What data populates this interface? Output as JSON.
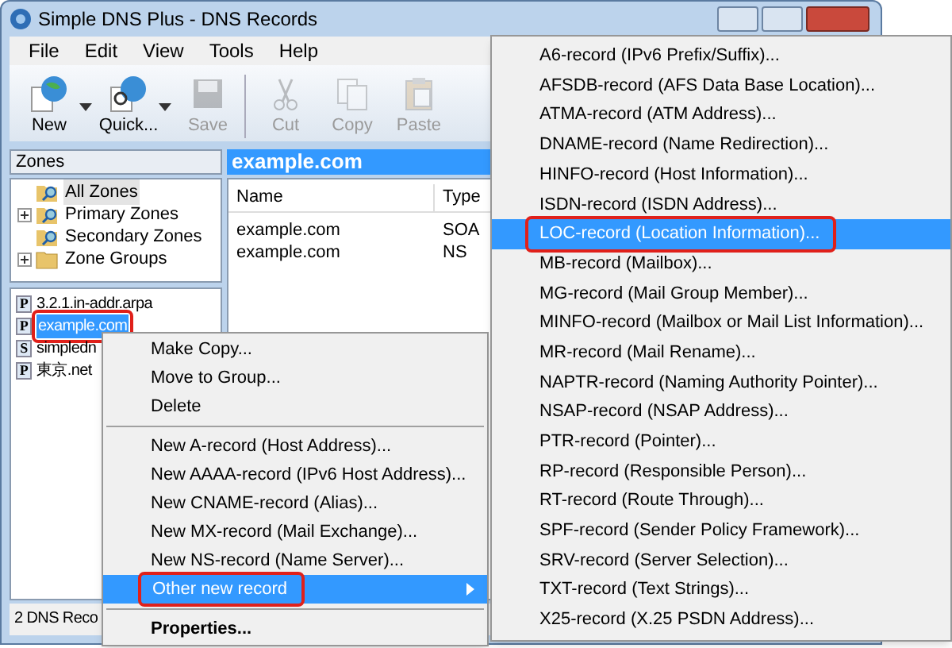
{
  "window": {
    "title": "Simple DNS Plus - DNS Records"
  },
  "menu_bar": [
    "File",
    "Edit",
    "View",
    "Tools",
    "Help"
  ],
  "toolbar": [
    {
      "label": "New",
      "kind": "new",
      "dropdown": true,
      "disabled": false
    },
    {
      "label": "Quick...",
      "kind": "quick",
      "dropdown": true,
      "disabled": false
    },
    {
      "label": "Save",
      "kind": "save",
      "dropdown": false,
      "disabled": true
    },
    {
      "label": "Cut",
      "kind": "cut",
      "dropdown": false,
      "disabled": true
    },
    {
      "label": "Copy",
      "kind": "copy",
      "dropdown": false,
      "disabled": true
    },
    {
      "label": "Paste",
      "kind": "paste",
      "dropdown": false,
      "disabled": true
    }
  ],
  "zones_panel": {
    "title": "Zones",
    "tree": [
      {
        "label": "All Zones",
        "kind": "search",
        "selected": true
      },
      {
        "label": "Primary Zones",
        "kind": "search",
        "selected": false,
        "expanded": false
      },
      {
        "label": "Secondary Zones",
        "kind": "search",
        "selected": false
      },
      {
        "label": "Zone Groups",
        "kind": "folder",
        "selected": false,
        "expanded": false
      }
    ],
    "zones": [
      {
        "badge": "P",
        "name": "3.2.1.in-addr.arpa",
        "selected": false,
        "highlighted": false
      },
      {
        "badge": "P",
        "name": "example.com",
        "selected": true,
        "highlighted": true
      },
      {
        "badge": "S",
        "name": "simpledn",
        "selected": false,
        "highlighted": false
      },
      {
        "badge": "P",
        "name": "東京.net",
        "selected": false,
        "highlighted": false
      }
    ]
  },
  "records_panel": {
    "title": "example.com",
    "columns": [
      "Name",
      "Type"
    ],
    "rows": [
      [
        "example.com",
        "SOA"
      ],
      [
        "example.com",
        "NS"
      ]
    ]
  },
  "status_bar": "2 DNS Reco",
  "context_menu": [
    {
      "kind": "item",
      "label": "Make Copy...",
      "selected": false,
      "bold": false,
      "submenu": false,
      "highlighted": false
    },
    {
      "kind": "item",
      "label": "Move to Group...",
      "selected": false,
      "bold": false,
      "submenu": false,
      "highlighted": false
    },
    {
      "kind": "item",
      "label": "Delete",
      "selected": false,
      "bold": false,
      "submenu": false,
      "highlighted": false
    },
    {
      "kind": "separator"
    },
    {
      "kind": "item",
      "label": "New A-record (Host Address)...",
      "selected": false,
      "bold": false,
      "submenu": false,
      "highlighted": false
    },
    {
      "kind": "item",
      "label": "New AAAA-record (IPv6 Host Address)...",
      "selected": false,
      "bold": false,
      "submenu": false,
      "highlighted": false
    },
    {
      "kind": "item",
      "label": "New CNAME-record (Alias)...",
      "selected": false,
      "bold": false,
      "submenu": false,
      "highlighted": false
    },
    {
      "kind": "item",
      "label": "New MX-record (Mail Exchange)...",
      "selected": false,
      "bold": false,
      "submenu": false,
      "highlighted": false
    },
    {
      "kind": "item",
      "label": "New NS-record (Name Server)...",
      "selected": false,
      "bold": false,
      "submenu": false,
      "highlighted": false
    },
    {
      "kind": "item",
      "label": "Other new record",
      "selected": true,
      "bold": false,
      "submenu": true,
      "highlighted": true
    },
    {
      "kind": "separator"
    },
    {
      "kind": "item",
      "label": "Properties...",
      "selected": false,
      "bold": true,
      "submenu": false,
      "highlighted": false
    }
  ],
  "submenu": [
    {
      "label": "A6-record (IPv6 Prefix/Suffix)...",
      "selected": false,
      "highlighted": false
    },
    {
      "label": "AFSDB-record (AFS Data Base Location)...",
      "selected": false,
      "highlighted": false
    },
    {
      "label": "ATMA-record (ATM Address)...",
      "selected": false,
      "highlighted": false
    },
    {
      "label": "DNAME-record (Name Redirection)...",
      "selected": false,
      "highlighted": false
    },
    {
      "label": "HINFO-record (Host Information)...",
      "selected": false,
      "highlighted": false
    },
    {
      "label": "ISDN-record (ISDN Address)...",
      "selected": false,
      "highlighted": false
    },
    {
      "label": "LOC-record (Location Information)...",
      "selected": true,
      "highlighted": true
    },
    {
      "label": "MB-record (Mailbox)...",
      "selected": false,
      "highlighted": false
    },
    {
      "label": "MG-record (Mail Group Member)...",
      "selected": false,
      "highlighted": false
    },
    {
      "label": "MINFO-record (Mailbox or Mail List Information)...",
      "selected": false,
      "highlighted": false
    },
    {
      "label": "MR-record (Mail Rename)...",
      "selected": false,
      "highlighted": false
    },
    {
      "label": "NAPTR-record (Naming Authority Pointer)...",
      "selected": false,
      "highlighted": false
    },
    {
      "label": "NSAP-record (NSAP Address)...",
      "selected": false,
      "highlighted": false
    },
    {
      "label": "PTR-record (Pointer)...",
      "selected": false,
      "highlighted": false
    },
    {
      "label": "RP-record (Responsible Person)...",
      "selected": false,
      "highlighted": false
    },
    {
      "label": "RT-record (Route Through)...",
      "selected": false,
      "highlighted": false
    },
    {
      "label": "SPF-record (Sender Policy Framework)...",
      "selected": false,
      "highlighted": false
    },
    {
      "label": "SRV-record (Server Selection)...",
      "selected": false,
      "highlighted": false
    },
    {
      "label": "TXT-record (Text Strings)...",
      "selected": false,
      "highlighted": false
    },
    {
      "label": "X25-record (X.25 PSDN Address)...",
      "selected": false,
      "highlighted": false
    }
  ]
}
